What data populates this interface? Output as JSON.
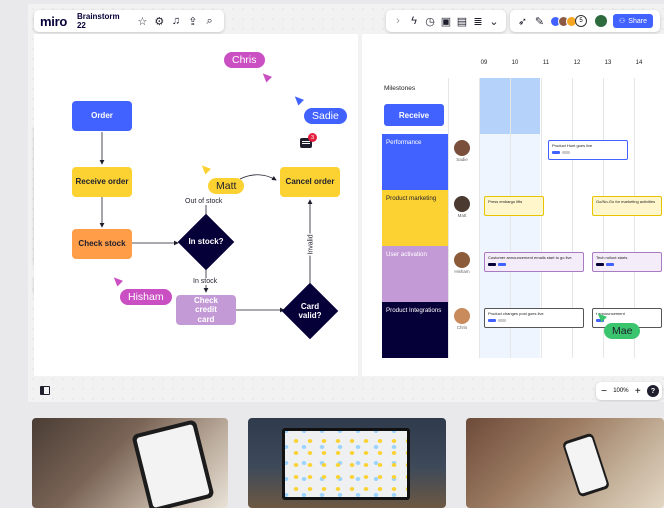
{
  "toolbar": {
    "logo": "miro",
    "board_name": "Brainstorm 22",
    "star_icon": "star-icon",
    "share_label": "Share",
    "collaborator_count": "5"
  },
  "flowchart": {
    "order": "Order",
    "receive_order": "Receive order",
    "check_stock": "Check stock",
    "in_stock_q": "In stock?",
    "cancel_order": "Cancel order",
    "check_credit_card": "Check credit card",
    "card_valid": "Card valid?",
    "out_of_stock_label": "Out of stock",
    "in_stock_label": "In stock",
    "invalid_label": "Invalid",
    "comment_count": "3"
  },
  "cursors": [
    {
      "name": "Chris",
      "color": "#c94fc2"
    },
    {
      "name": "Sadie",
      "color": "#4262ff"
    },
    {
      "name": "Matt",
      "color": "#fcd233"
    },
    {
      "name": "Hisham",
      "color": "#c94fc2"
    },
    {
      "name": "Mae",
      "color": "#3bc46e"
    }
  ],
  "timeline": {
    "columns": [
      "09",
      "10",
      "11",
      "12",
      "13",
      "14"
    ],
    "milestones_label": "Milestones",
    "receive_label": "Receive",
    "rows": [
      {
        "label": "Performance",
        "person": "Sadie",
        "color": "#4262ff"
      },
      {
        "label": "Product marketing",
        "person": "Matt",
        "color": "#fcd233"
      },
      {
        "label": "User activation",
        "person": "Hisham",
        "color": "#c49ad6"
      },
      {
        "label": "Product Integrations",
        "person": "Chris",
        "color": "#050038"
      }
    ],
    "cards": {
      "product_hunt": "Product Hunt goes live",
      "press_embargo": "Press embargo lifts",
      "go_to_market": "Go/No-Go for marketing activities",
      "customer_emails": "Customer announcement emails start to go live",
      "tech_rollout": "Tech rollout starts",
      "product_changes": "Product changes post goes live",
      "announcement": "t announcement"
    }
  },
  "zoom": {
    "minus": "−",
    "level": "100%",
    "plus": "+",
    "help": "?"
  }
}
